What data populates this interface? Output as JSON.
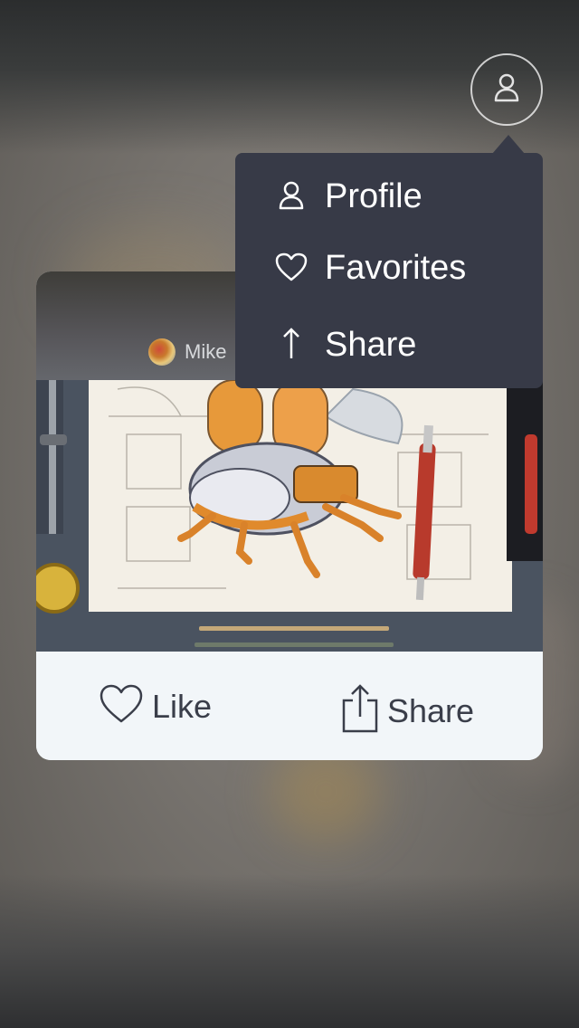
{
  "header": {
    "profile_button_icon": "user-icon"
  },
  "menu": {
    "items": [
      {
        "label": "Profile",
        "icon": "user-icon"
      },
      {
        "label": "Favorites",
        "icon": "heart-icon"
      },
      {
        "label": "Share",
        "icon": "arrow-up-icon"
      }
    ],
    "background": "#373a47"
  },
  "card": {
    "author": {
      "name": "Mike"
    },
    "image": {
      "subject": "robot-beetle-illustration"
    },
    "actions": {
      "like_label": "Like",
      "share_label": "Share"
    },
    "actions_background": "#f2f6f9"
  }
}
